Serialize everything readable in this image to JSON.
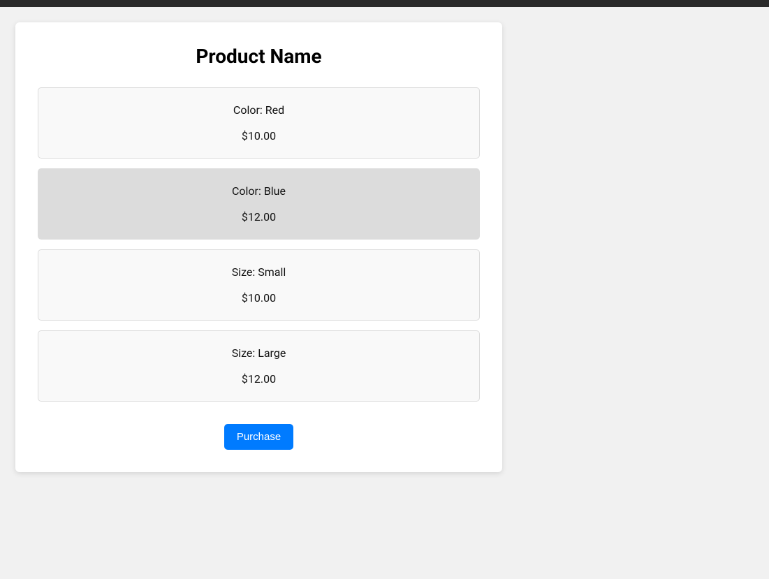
{
  "product": {
    "title": "Product Name"
  },
  "options": [
    {
      "label": "Color: Red",
      "price": "$10.00",
      "selected": false
    },
    {
      "label": "Color: Blue",
      "price": "$12.00",
      "selected": true
    },
    {
      "label": "Size: Small",
      "price": "$10.00",
      "selected": false
    },
    {
      "label": "Size: Large",
      "price": "$12.00",
      "selected": false
    }
  ],
  "actions": {
    "purchase_label": "Purchase"
  }
}
